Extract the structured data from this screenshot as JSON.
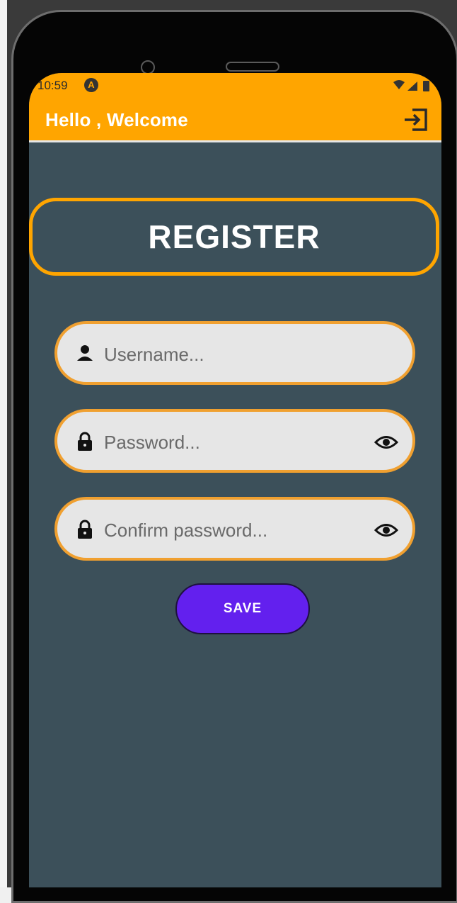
{
  "status_bar": {
    "time": "10:59",
    "badge_icon": "android-system-icon"
  },
  "app_bar": {
    "title": "Hello , Welcome",
    "action_icon": "logout-icon"
  },
  "header": {
    "title": "REGISTER"
  },
  "form": {
    "username": {
      "value": "",
      "placeholder": "Username...",
      "icon": "person-icon"
    },
    "password": {
      "value": "",
      "placeholder": "Password...",
      "icon": "lock-icon",
      "toggle_icon": "eye-icon"
    },
    "confirm_password": {
      "value": "",
      "placeholder": "Confirm password...",
      "icon": "lock-icon",
      "toggle_icon": "eye-icon"
    }
  },
  "actions": {
    "save_label": "SAVE"
  },
  "colors": {
    "app_bar": "#ffa500",
    "background": "#3c505a",
    "field_border": "#f0a030",
    "button": "#6320ee"
  }
}
